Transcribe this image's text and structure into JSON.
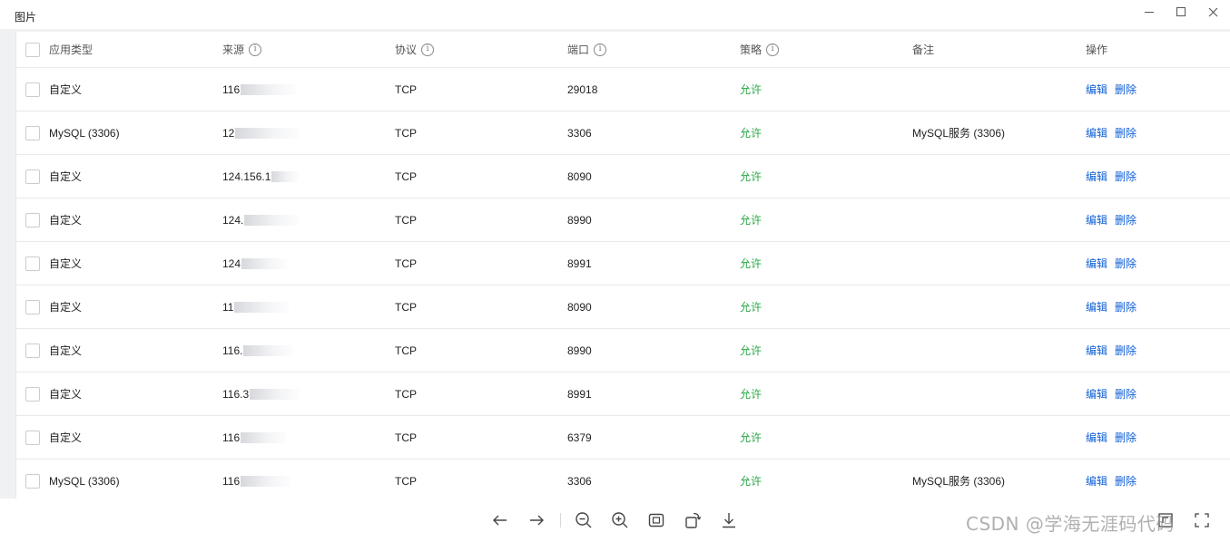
{
  "window": {
    "title": "图片"
  },
  "table": {
    "headers": {
      "type": "应用类型",
      "source": "来源",
      "protocol": "协议",
      "port": "端口",
      "policy": "策略",
      "note": "备注",
      "ops": "操作"
    },
    "edit_label": "编辑",
    "delete_label": "删除",
    "rows": [
      {
        "type": "自定义",
        "source": "116",
        "protocol": "TCP",
        "port": "29018",
        "policy": "允许",
        "note": ""
      },
      {
        "type": "MySQL (3306)",
        "source": "12",
        "protocol": "TCP",
        "port": "3306",
        "policy": "允许",
        "note": "MySQL服务 (3306)"
      },
      {
        "type": "自定义",
        "source": "124.156.1",
        "protocol": "TCP",
        "port": "8090",
        "policy": "允许",
        "note": ""
      },
      {
        "type": "自定义",
        "source": "124.",
        "protocol": "TCP",
        "port": "8990",
        "policy": "允许",
        "note": ""
      },
      {
        "type": "自定义",
        "source": "124",
        "protocol": "TCP",
        "port": "8991",
        "policy": "允许",
        "note": ""
      },
      {
        "type": "自定义",
        "source": "11",
        "protocol": "TCP",
        "port": "8090",
        "policy": "允许",
        "note": ""
      },
      {
        "type": "自定义",
        "source": "116.",
        "protocol": "TCP",
        "port": "8990",
        "policy": "允许",
        "note": ""
      },
      {
        "type": "自定义",
        "source": "116.3",
        "protocol": "TCP",
        "port": "8991",
        "policy": "允许",
        "note": ""
      },
      {
        "type": "自定义",
        "source": "116",
        "protocol": "TCP",
        "port": "6379",
        "policy": "允许",
        "note": ""
      },
      {
        "type": "MySQL (3306)",
        "source": "116",
        "protocol": "TCP",
        "port": "3306",
        "policy": "允许",
        "note": "MySQL服务 (3306)"
      }
    ]
  },
  "toolbar": {
    "icons": [
      "arrow-left-icon",
      "arrow-right-icon",
      "zoom-out-icon",
      "zoom-in-icon",
      "fit-screen-icon",
      "rotate-icon",
      "download-icon"
    ]
  },
  "watermark": "CSDN @学海无涯码代码",
  "colors": {
    "allow": "#29a745",
    "link": "#0f5fd6",
    "viewport_bg": "#f0f1f3"
  }
}
